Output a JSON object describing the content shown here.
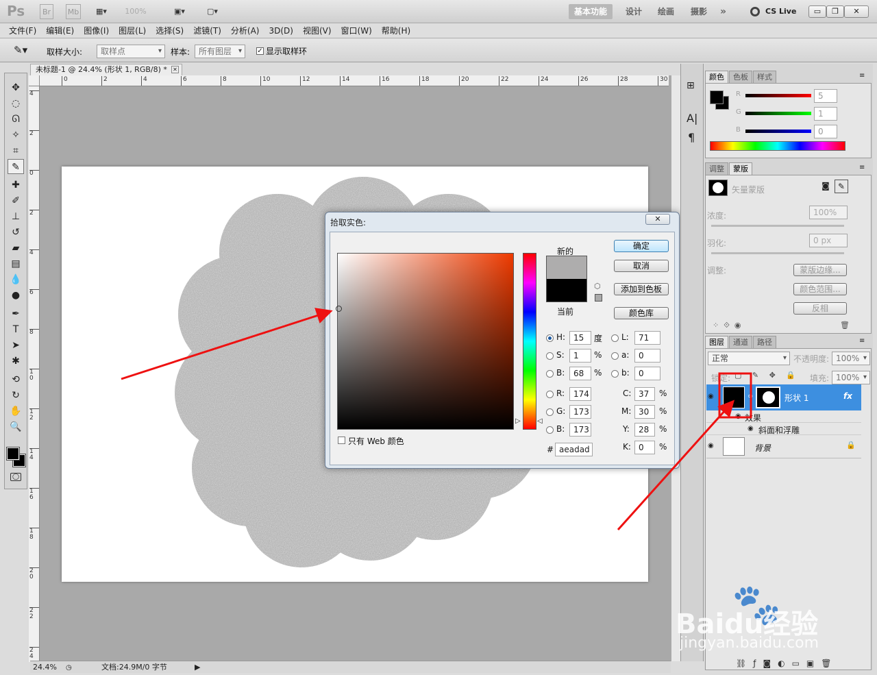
{
  "app": {
    "logo": "Ps",
    "mini_buttons": [
      "Br",
      "Mb"
    ],
    "zoom": "100%",
    "workspaces": [
      "基本功能",
      "设计",
      "绘画",
      "摄影"
    ],
    "overflow": "»",
    "cslive": "CS Live",
    "window_buttons": [
      "▭",
      "❐",
      "✕"
    ]
  },
  "menu": [
    "文件(F)",
    "编辑(E)",
    "图像(I)",
    "图层(L)",
    "选择(S)",
    "滤镜(T)",
    "分析(A)",
    "3D(D)",
    "视图(V)",
    "窗口(W)",
    "帮助(H)"
  ],
  "options": {
    "sample_size_label": "取样大小:",
    "sample_size_value": "取样点",
    "sample_label": "样本:",
    "sample_value": "所有图层",
    "show_ring_label": "显示取样环"
  },
  "document": {
    "tab_title": "未标题-1 @ 24.4% (形状 1, RGB/8) *",
    "ruler_h": [
      "0",
      "2",
      "4",
      "6",
      "8",
      "10",
      "12",
      "14",
      "16",
      "18",
      "20",
      "22",
      "24",
      "26",
      "28",
      "30"
    ],
    "ruler_v": [
      "4",
      "2",
      "0",
      "2",
      "4",
      "6",
      "8",
      "1 0",
      "1 2",
      "1 4",
      "1 6",
      "1 8",
      "2 0",
      "2 2",
      "2 4"
    ],
    "status_zoom": "24.4%",
    "status_doc": "文档:24.9M/0 字节"
  },
  "picker": {
    "title": "拾取实色:",
    "ok": "确定",
    "cancel": "取消",
    "add_swatch": "添加到色板",
    "color_lib": "颜色库",
    "new_label": "新的",
    "current_label": "当前",
    "new_color": "#aeadad",
    "current_color": "#000000",
    "web_only": "只有 Web 颜色",
    "H": "15",
    "S": "1",
    "B": "68",
    "R": "174",
    "G": "173",
    "Bl": "173",
    "L": "71",
    "a": "0",
    "b": "0",
    "C": "37",
    "M": "30",
    "Y": "28",
    "K": "0",
    "unit_deg": "度",
    "unit_pct": "%",
    "hex": "aeadad"
  },
  "panels": {
    "color_tabs": [
      "颜色",
      "色板",
      "样式"
    ],
    "r_val": "5",
    "g_val": "1",
    "b_val": "0",
    "adj_tabs": [
      "调整",
      "蒙版"
    ],
    "mask_title": "矢量蒙版",
    "density_label": "浓度:",
    "density_val": "100%",
    "feather_label": "羽化:",
    "feather_val": "0 px",
    "adjust_label": "调整:",
    "mask_edge": "蒙版边缘...",
    "color_range": "颜色范围...",
    "invert": "反相",
    "layer_tabs": [
      "图层",
      "通道",
      "路径"
    ],
    "blend_mode": "正常",
    "opacity_label": "不透明度:",
    "opacity_val": "100%",
    "lock_label": "锁定:",
    "fill_label": "填充:",
    "fill_val": "100%",
    "layers": [
      {
        "name": "形状 1",
        "fx": "fx"
      },
      {
        "name": "效果"
      },
      {
        "name": "斜面和浮雕"
      },
      {
        "name": "背景"
      }
    ]
  },
  "watermark": {
    "line1": "Baidu经验",
    "line2": "jingyan.baidu.com"
  }
}
